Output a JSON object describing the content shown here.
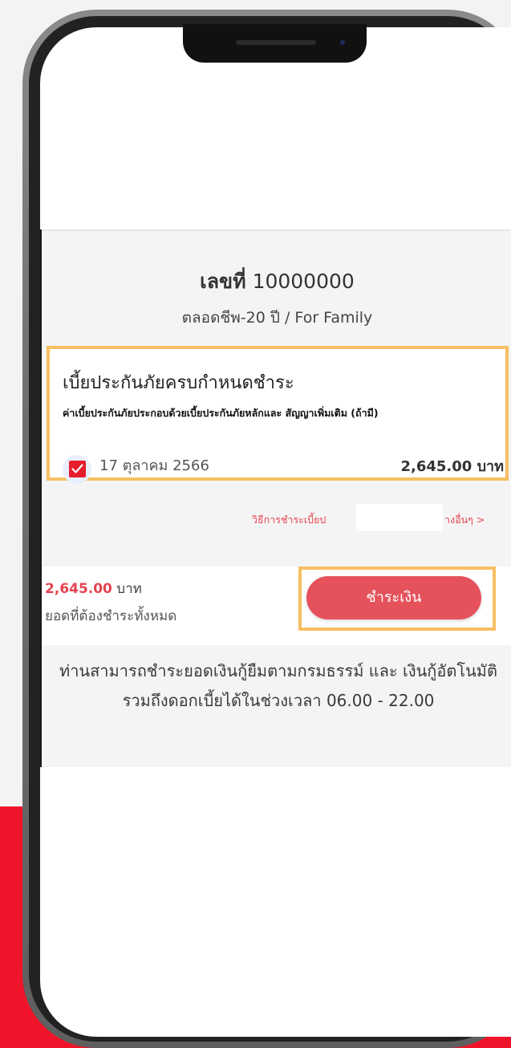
{
  "policy": {
    "number_label": "เลขที่",
    "number_value": "10000000",
    "plan_name": "ตลอดชีพ-20 ปี / For Family"
  },
  "due": {
    "title": "เบี้ยประกันภัยครบกำหนดชำระ",
    "note": "ค่าเบี้ยประกันภัยประกอบด้วยเบี้ยประกันภัยหลักและ สัญญาเพิ่มเติม (ถ้ามี)",
    "checked": true,
    "date": "17 ตุลาคม 2566",
    "amount": "2,645.00 บาท"
  },
  "other_methods": {
    "left_text": "วิธีการชำระเบี้ยป",
    "right_text": "างอื่นๆ >"
  },
  "payment": {
    "total_number": "2,645.00",
    "total_unit": " บาท",
    "total_label": "ยอดที่ต้องชำระทั้งหมด",
    "button_label": "ชำระเงิน"
  },
  "footer": {
    "note": "ท่านสามารถชำระยอดเงินกู้ยืมตามกรมธรรม์ และ เงินกู้อัตโนมัติ รวมถึงดอกเบี้ยได้ในช่วงเวลา 06.00 - 22.00"
  },
  "colors": {
    "accent": "#e5444f",
    "highlight_border": "#f6bf63",
    "background_band": "#f0142a"
  },
  "icons": {
    "checkbox": "checkmark-icon"
  }
}
